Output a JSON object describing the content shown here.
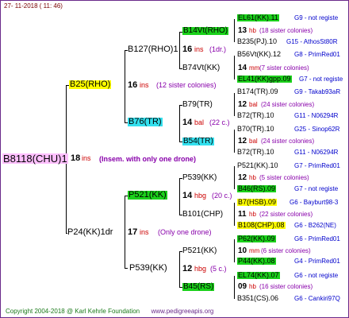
{
  "header": {
    "date": "27- 11-2018 ( 11: 46)"
  },
  "root": {
    "id": "B8118(CHU)1",
    "gen": "18",
    "unit": "ins",
    "note": "(Insem. with only one drone)"
  },
  "mother": {
    "id": "B25(RHO)",
    "gen": "16",
    "unit": "ins",
    "note": "(12 sister colonies)"
  },
  "father": {
    "id": "P24(KK)1dr",
    "gen": "17",
    "unit": "ins",
    "note": "(Only one drone)"
  },
  "level3": {
    "b127": {
      "id": "B127(RHO)1",
      "gen": "16",
      "unit": "ins",
      "note": "(1dr.)"
    },
    "b76": {
      "id": "B76(TR)",
      "gen": "14",
      "unit": "bal",
      "note": "(22 c.)"
    },
    "p521": {
      "id": "P521(KK)",
      "gen": "14",
      "unit": "hbg",
      "note": "(20 c.)"
    },
    "p539": {
      "id": "P539(KK)",
      "gen": "12",
      "unit": "hbg",
      "note": "(5 c.)"
    }
  },
  "level4": {
    "b14": {
      "id": "B14Vt(RHO)",
      "gen": "13",
      "unit": "hb",
      "note": "(18 sister colonies)"
    },
    "b74": {
      "id": "B74Vt(KK)",
      "gen": "14",
      "unit": "mm",
      "note": "(7 sister colonies)"
    },
    "b79": {
      "id": "B79(TR)",
      "gen": "12",
      "unit": "bal",
      "note": "(24 sister colonies)"
    },
    "b54": {
      "id": "B54(TR)",
      "gen": "12",
      "unit": "bal",
      "note": "(24 sister colonies)"
    },
    "p539": {
      "id": "P539(KK)",
      "gen": "12",
      "unit": "hb",
      "note": "(5 sister colonies)"
    },
    "b101": {
      "id": "B101(CHP)",
      "gen": "11",
      "unit": "hb",
      "note": "(22 sister colonies)"
    },
    "p521": {
      "id": "P521(KK)",
      "gen": "10",
      "unit": "mm",
      "note": "(6 sister colonies)"
    },
    "b45": {
      "id": "B45(RS)",
      "gen": "09",
      "unit": "hb",
      "note": "(16 sister colonies)"
    }
  },
  "level5": [
    {
      "id": "EL61(KK).11",
      "gen": "G9 - not registe"
    },
    {
      "id": "B235(PJ).10",
      "gen": "G15 - AthosSt80R"
    },
    {
      "id": "B56Vt(KK).12",
      "gen": "G8 - PrimRed01"
    },
    {
      "id": "EL41(KK)gpp.09",
      "gen": "G7 - not registe"
    },
    {
      "id": "B174(TR).09",
      "gen": "G9 - Takab93aR"
    },
    {
      "id": "B72(TR).10",
      "gen": "G11 - N06294R"
    },
    {
      "id": "B70(TR).10",
      "gen": "G25 - Sinop62R"
    },
    {
      "id": "B72(TR).10",
      "gen": "G11 - N06294R"
    },
    {
      "id": "P521(KK).10",
      "gen": "G7 - PrimRed01"
    },
    {
      "id": "B46(RS).09",
      "gen": "G7 - not registe"
    },
    {
      "id": "B7(HSB).09",
      "gen": "G6 - Bayburt98-3"
    },
    {
      "id": "B108(CHP).08",
      "gen": "G6 - B262(NE)"
    },
    {
      "id": "P62(KK).09",
      "gen": "G6 - PrimRed01"
    },
    {
      "id": "P44(KK).08",
      "gen": "G4 - PrimRed01"
    },
    {
      "id": "EL74(KK).07",
      "gen": "G6 - not registe"
    },
    {
      "id": "B351(CS).06",
      "gen": "G6 - Cankiri97Q"
    }
  ],
  "footer": {
    "copyright": "Copyright 2004-2018 @ Karl Kehrle Foundation",
    "url": "www.pedigreeapis.org"
  }
}
